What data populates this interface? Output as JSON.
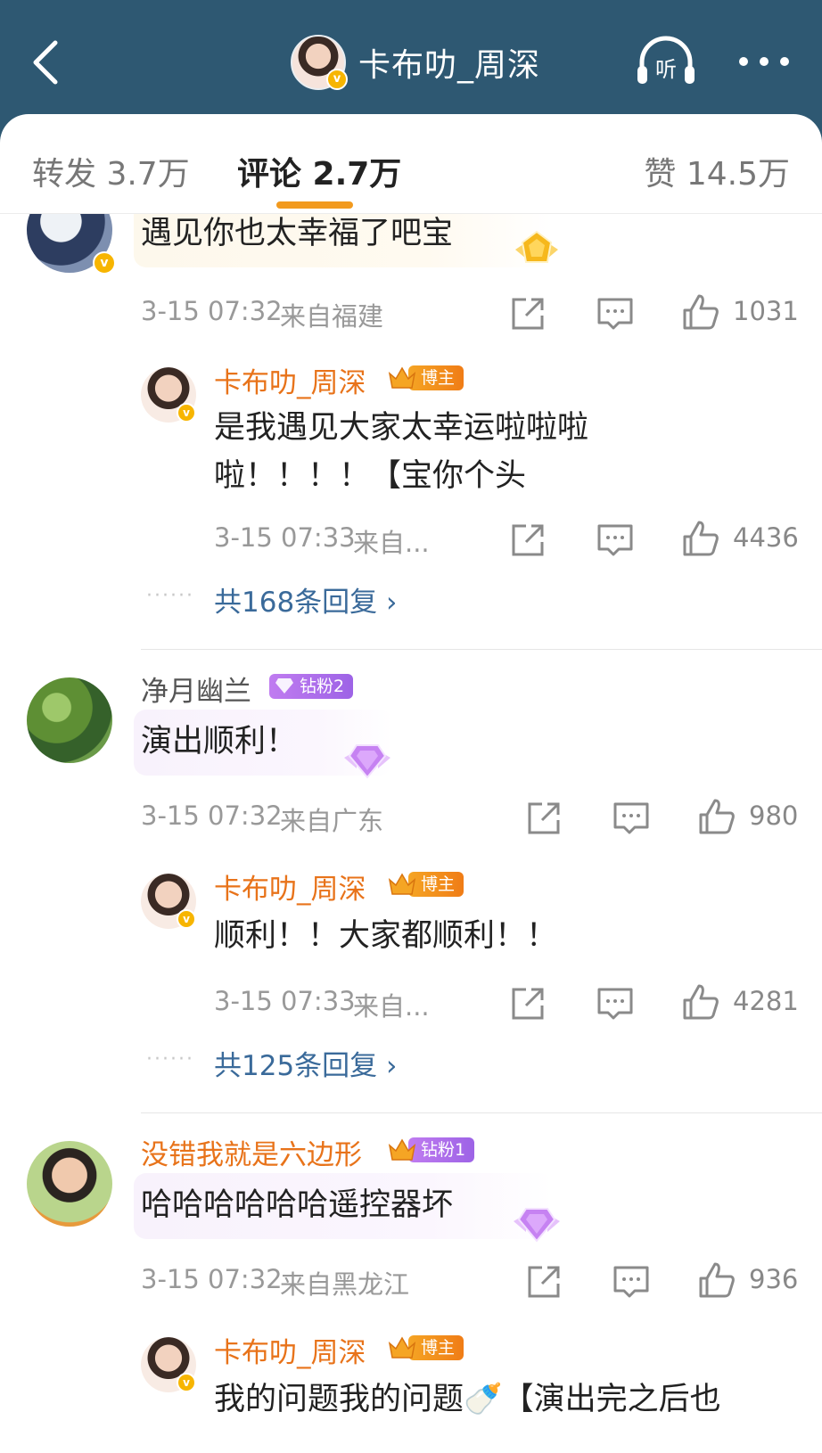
{
  "header": {
    "title": "卡布叻_周深",
    "listen_label": "听"
  },
  "tabs": [
    {
      "label": "转发 3.7万"
    },
    {
      "label": "评论 2.7万"
    },
    {
      "label": "赞 14.5万"
    }
  ],
  "comments": [
    {
      "text": "遇见你也太幸福了吧宝",
      "time": "3-15 07:32",
      "location": "来自福建",
      "likes": "1031",
      "reply": {
        "name": "卡布叻_周深",
        "badge": "博主",
        "text_line1": "是我遇见大家太幸运啦啦啦",
        "text_line2": "啦！！！！【宝你个头",
        "time": "3-15 07:33",
        "location": "来自...",
        "likes": "4436"
      },
      "more_replies": "共168条回复 ›"
    },
    {
      "name": "净月幽兰",
      "badge": "钻粉2",
      "text": "演出顺利！",
      "time": "3-15 07:32",
      "location": "来自广东",
      "likes": "980",
      "reply": {
        "name": "卡布叻_周深",
        "badge": "博主",
        "text_line1": "顺利！！大家都顺利！！",
        "time": "3-15 07:33",
        "location": "来自...",
        "likes": "4281"
      },
      "more_replies": "共125条回复 ›"
    },
    {
      "name": "没错我就是六边形",
      "badge": "钻粉1",
      "text": "哈哈哈哈哈哈遥控器坏",
      "time": "3-15 07:32",
      "location": "来自黑龙江",
      "likes": "936",
      "reply": {
        "name": "卡布叻_周深",
        "badge": "博主",
        "text_line1": "我的问题我的问题🍼【演出完之后也"
      }
    }
  ],
  "colors": {
    "header_bg": "#2e5872",
    "accent_orange": "#f29a1e",
    "name_orange": "#e8731a",
    "link_blue": "#3a6a9a",
    "verified_gold": "#f7b500",
    "fan_purple": "#9d63e6"
  }
}
